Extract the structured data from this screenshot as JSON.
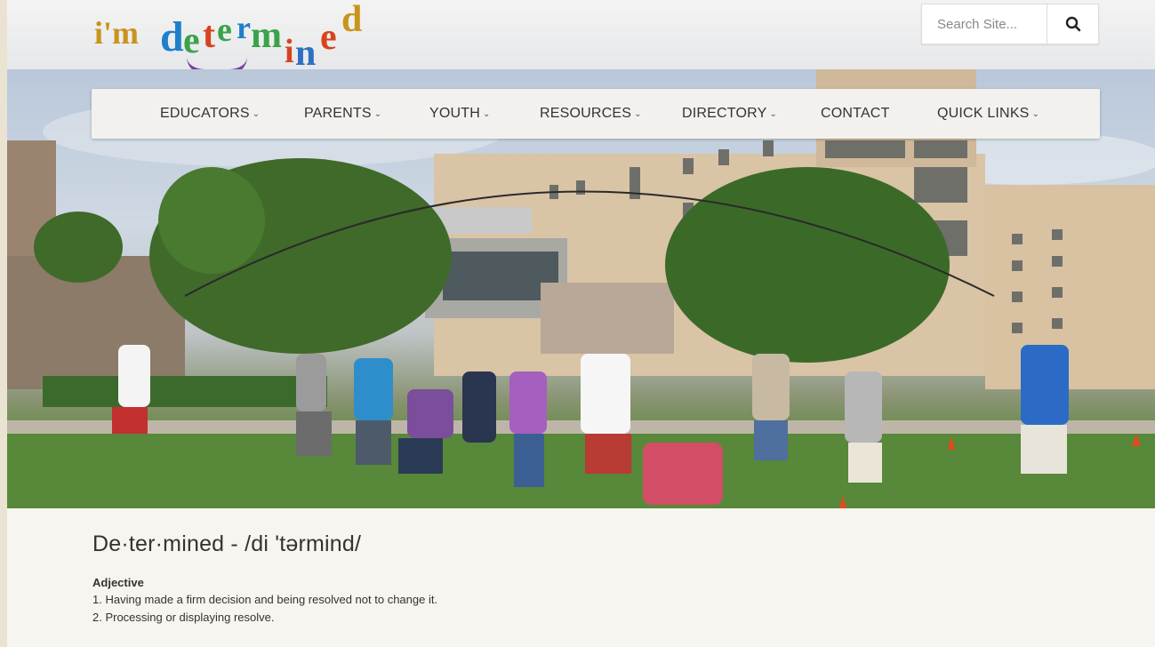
{
  "logo": {
    "text_parts": [
      "i'm",
      "d",
      "e",
      "t",
      "e",
      "r",
      "m",
      "i",
      "n",
      "e",
      "d"
    ],
    "colors": {
      "im": "#c8941a",
      "d1": "#1f7fc9",
      "e1": "#3aa34a",
      "t": "#d6431e",
      "e2": "#3aa34a",
      "r": "#1f7fc9",
      "m": "#3aa34a",
      "i": "#d6431e",
      "n": "#2f6fc2",
      "e3": "#d6431e",
      "d2": "#c8941a",
      "smile": "#7b3fa0"
    }
  },
  "search": {
    "placeholder": "Search Site...",
    "icon": "search-icon"
  },
  "nav": {
    "items": [
      {
        "label": "EDUCATORS",
        "dropdown": true
      },
      {
        "label": "PARENTS",
        "dropdown": true
      },
      {
        "label": "YOUTH",
        "dropdown": true
      },
      {
        "label": "RESOURCES",
        "dropdown": true
      },
      {
        "label": "DIRECTORY",
        "dropdown": true
      },
      {
        "label": "CONTACT",
        "dropdown": false
      },
      {
        "label": "QUICK LINKS",
        "dropdown": true
      }
    ],
    "chevron": "⌄"
  },
  "content": {
    "title": "De·ter·mined - /di 'tərmind/",
    "part_of_speech": "Adjective",
    "definitions": [
      "1. Having made a firm decision and being resolved not to change it.",
      "2. Processing or displaying resolve."
    ]
  }
}
